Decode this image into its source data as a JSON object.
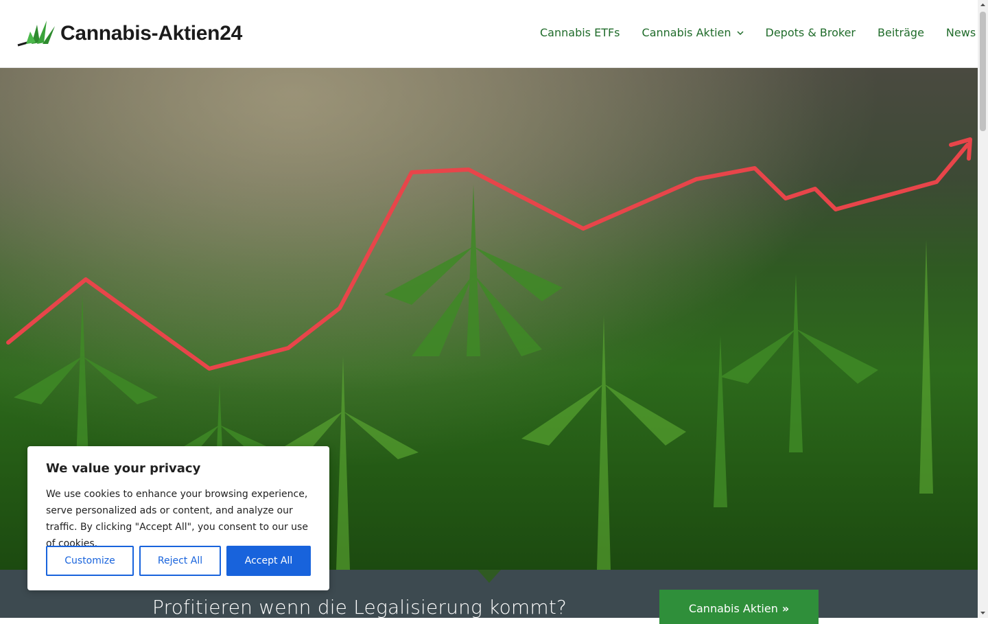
{
  "header": {
    "logo_text": "Cannabis-Aktien24",
    "nav": [
      {
        "label": "Cannabis ETFs"
      },
      {
        "label": "Cannabis Aktien",
        "has_dropdown": true
      },
      {
        "label": "Depots & Broker"
      },
      {
        "label": "Beiträge"
      },
      {
        "label": "News"
      }
    ]
  },
  "hero": {
    "image": "cannabis plants field with red rising trend line",
    "trend_color": "#e8454a"
  },
  "band": {
    "tagline": "Profitieren wenn die Legalisierung kommt?",
    "cta_label": "Cannabis Aktien",
    "cta_icon": "double-chevron-right-icon"
  },
  "cookie": {
    "title": "We value your privacy",
    "text": "We use cookies to enhance your browsing experience, serve personalized ads or content, and analyze our traffic. By clicking \"Accept All\", you consent to our use of cookies.",
    "buttons": {
      "customize": "Customize",
      "reject": "Reject All",
      "accept": "Accept All"
    }
  },
  "colors": {
    "nav_text": "#1f6b2a",
    "band_bg": "#3d4a50",
    "cta_bg": "#2f8f3a",
    "cookie_accent": "#1863dc"
  }
}
